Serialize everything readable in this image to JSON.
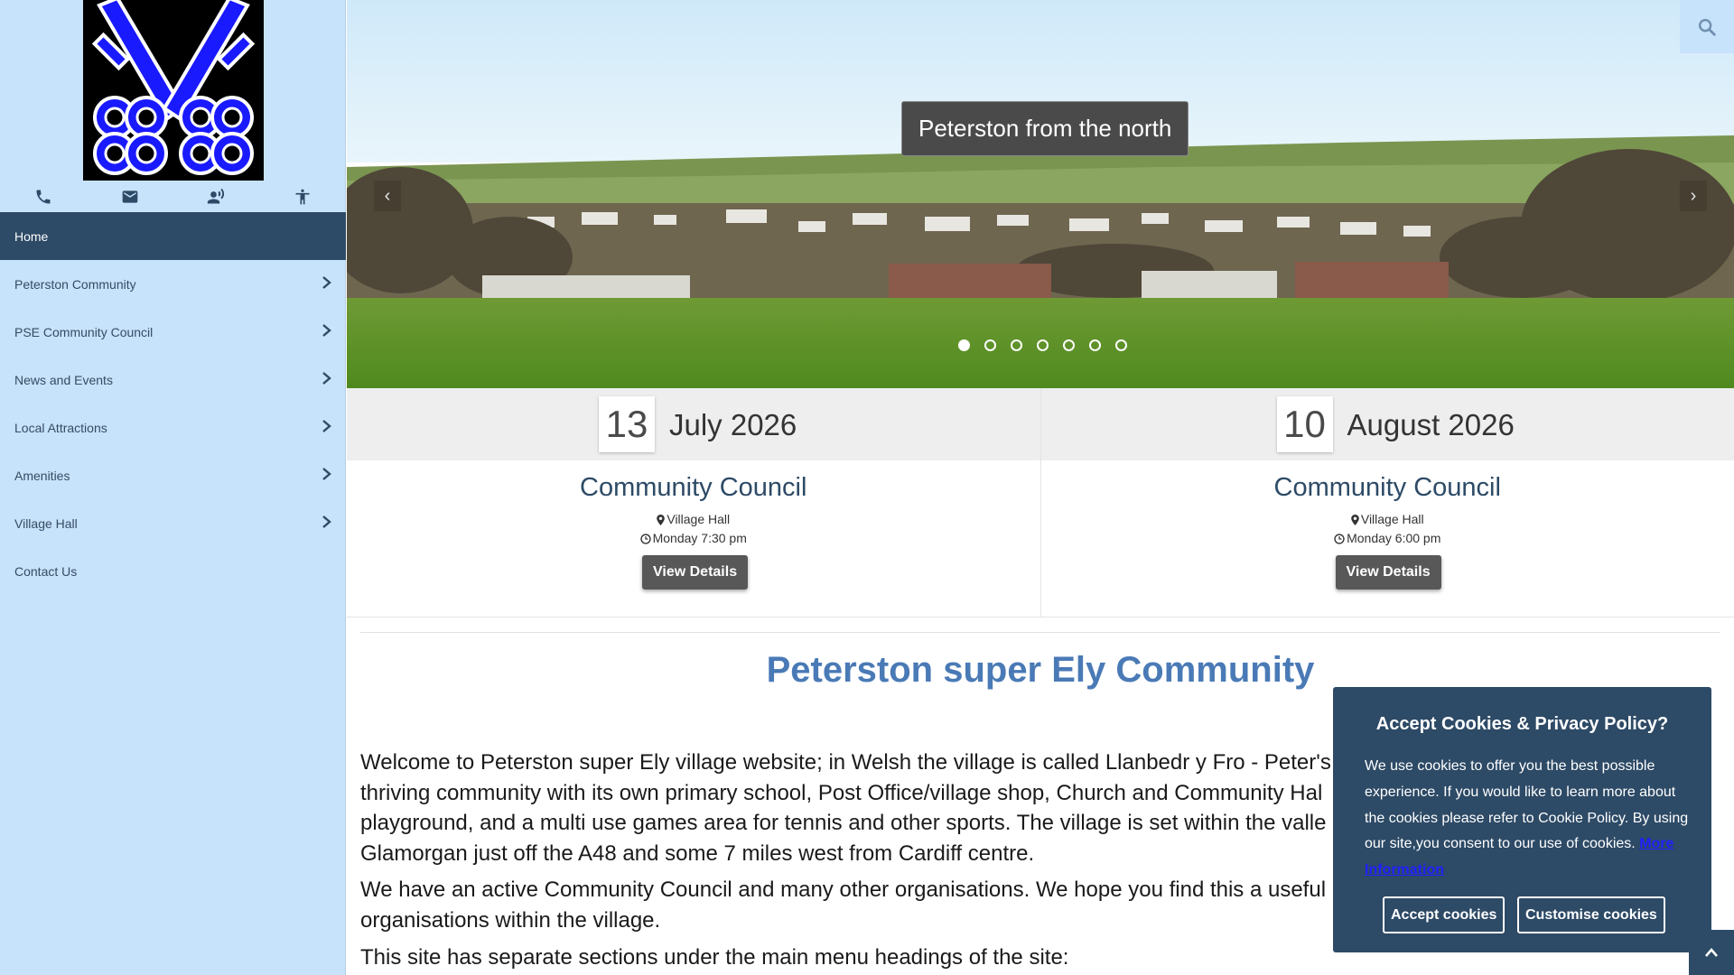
{
  "sidebar": {
    "logo_alt": "Peterston crossed keys logo",
    "quick_icons": [
      "phone-icon",
      "email-icon",
      "voice-icon",
      "accessibility-icon"
    ],
    "nav": [
      {
        "label": "Home",
        "active": true,
        "has_submenu": false
      },
      {
        "label": "Peterston Community",
        "active": false,
        "has_submenu": true
      },
      {
        "label": "PSE Community Council",
        "active": false,
        "has_submenu": true
      },
      {
        "label": "News and Events",
        "active": false,
        "has_submenu": true
      },
      {
        "label": "Local Attractions",
        "active": false,
        "has_submenu": true
      },
      {
        "label": "Amenities",
        "active": false,
        "has_submenu": true
      },
      {
        "label": "Village Hall",
        "active": false,
        "has_submenu": true
      },
      {
        "label": "Contact Us",
        "active": false,
        "has_submenu": false
      }
    ]
  },
  "hero": {
    "caption": "Peterston from the north",
    "prev_label": "‹",
    "next_label": "›",
    "slide_count": 7,
    "active_slide": 1
  },
  "events": [
    {
      "day": "13",
      "month": "July 2026",
      "title": "Community Council",
      "location": "Village Hall",
      "time": "Monday 7:30 pm",
      "button": "View Details"
    },
    {
      "day": "10",
      "month": "August 2026",
      "title": "Community Council",
      "location": "Village Hall",
      "time": "Monday 6:00 pm",
      "button": "View Details"
    }
  ],
  "content": {
    "title": "Peterston super Ely Community",
    "paragraphs": [
      "Welcome to Peterston super Ely village website; in Welsh the village is called Llanbedr y Fro - Peter's",
      "thriving community with its own primary school, Post Office/village shop, Church and Community Hal",
      "playground, and a multi use games area for tennis and other sports. The village is set within the valle",
      "Glamorgan just off the A48 and some 7 miles west from Cardiff centre.",
      "We have an active Community Council and many other organisations. We hope you find this a useful",
      "organisations within the village.",
      "This site has separate sections under the main menu headings of the site:"
    ]
  },
  "cookie": {
    "title": "Accept Cookies & Privacy Policy?",
    "text": "We use cookies to offer you the best possible experience. If you would like to learn more about the cookies please refer to Cookie Policy. By using our site,you consent to our use of cookies.",
    "link": "More Information",
    "accept": "Accept cookies",
    "customise": "Customise cookies"
  },
  "colors": {
    "sidebar_bg": "#c7e2fb",
    "nav_active": "#2d4a66",
    "title_blue": "#4a7ab6",
    "cookie_bg": "#2d4a66",
    "logo_blue": "#1a1aff"
  }
}
